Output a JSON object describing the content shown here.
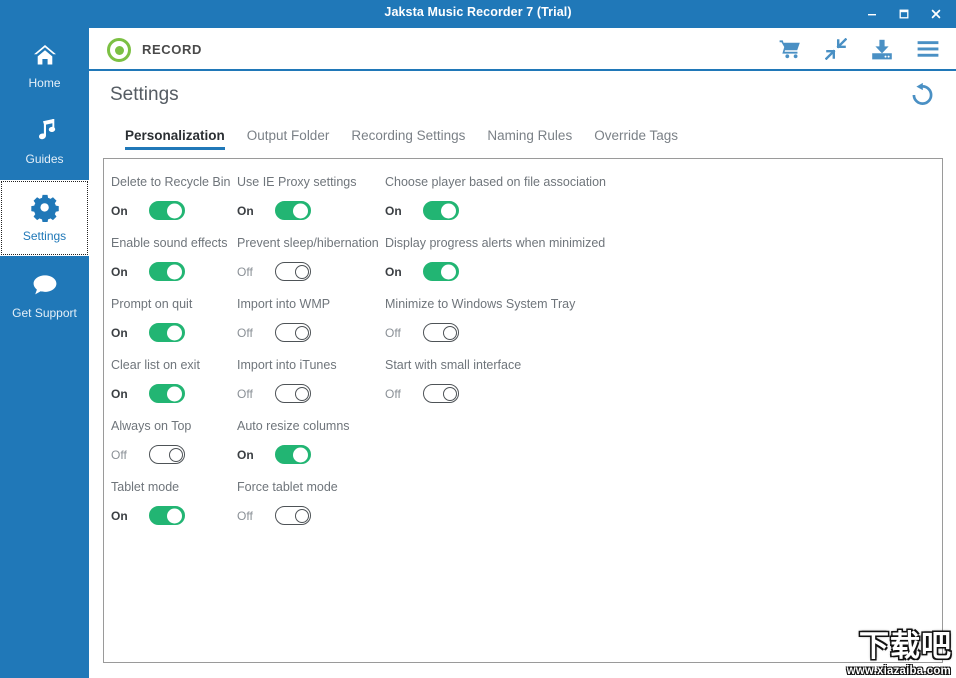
{
  "window": {
    "title": "Jaksta Music Recorder 7 (Trial)",
    "controls": [
      {
        "name": "minimize",
        "label": "–"
      },
      {
        "name": "maximize",
        "label": "□"
      },
      {
        "name": "close",
        "label": "✕"
      }
    ]
  },
  "sidebar": {
    "items": [
      {
        "label": "Home",
        "icon": "home-icon",
        "active": false
      },
      {
        "label": "Guides",
        "icon": "music-note-icon",
        "active": false
      },
      {
        "label": "Settings",
        "icon": "gear-icon",
        "active": true
      },
      {
        "label": "Get Support",
        "icon": "speech-bubble-icon",
        "active": false
      }
    ]
  },
  "appheader": {
    "logo_icon": "record-circle-icon",
    "mode_label": "RECORD",
    "icons": [
      {
        "name": "cart-icon",
        "label": "Buy"
      },
      {
        "name": "collapse-arrows-icon",
        "label": "Shrink"
      },
      {
        "name": "download-icon",
        "label": "Downloads"
      },
      {
        "name": "hamburger-menu-icon",
        "label": "Menu"
      }
    ]
  },
  "page": {
    "title": "Settings",
    "reset_icon": "reset-arrow-icon",
    "reset_label": "Reset to defaults"
  },
  "tabs": [
    {
      "label": "Personalization",
      "active": true
    },
    {
      "label": "Output Folder",
      "active": false
    },
    {
      "label": "Recording Settings",
      "active": false
    },
    {
      "label": "Naming Rules",
      "active": false
    },
    {
      "label": "Override Tags",
      "active": false
    }
  ],
  "settings": {
    "column1": [
      {
        "label": "Delete to Recycle Bin",
        "state": "On"
      },
      {
        "label": "Enable sound effects",
        "state": "On"
      },
      {
        "label": "Prompt on quit",
        "state": "On"
      },
      {
        "label": "Clear list on exit",
        "state": "On"
      },
      {
        "label": "Always on Top",
        "state": "Off"
      },
      {
        "label": "Tablet mode",
        "state": "On"
      }
    ],
    "column2": [
      {
        "label": "Use IE Proxy settings",
        "state": "On"
      },
      {
        "label": "Prevent sleep/hibernation",
        "state": "Off"
      },
      {
        "label": "Import into WMP",
        "state": "Off"
      },
      {
        "label": "Import into iTunes",
        "state": "Off"
      },
      {
        "label": "Auto resize columns",
        "state": "On"
      },
      {
        "label": "Force tablet mode",
        "state": "Off"
      }
    ],
    "column3": [
      {
        "label": "Choose player based on file association",
        "state": "On"
      },
      {
        "label": "Display progress alerts when minimized",
        "state": "On"
      },
      {
        "label": "Minimize to Windows System Tray",
        "state": "Off"
      },
      {
        "label": "Start with small interface",
        "state": "Off"
      }
    ]
  },
  "watermark": {
    "logo_text": "下载吧",
    "url": "www.xiazaiba.com"
  },
  "colors": {
    "brand_blue": "#2078b8",
    "toggle_green": "#22b573",
    "record_green": "#7cc043",
    "icon_blue": "#4a90c4"
  }
}
